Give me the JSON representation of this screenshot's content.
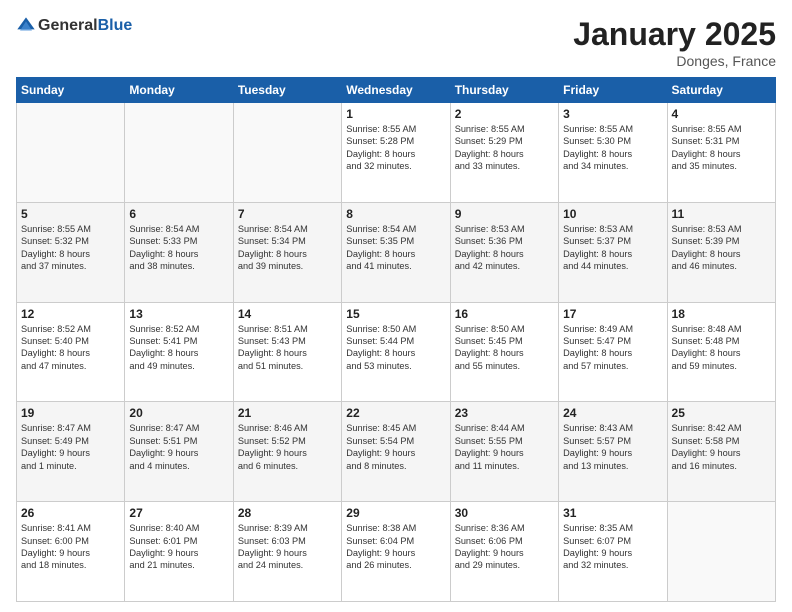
{
  "header": {
    "logo_general": "General",
    "logo_blue": "Blue",
    "title": "January 2025",
    "location": "Donges, France"
  },
  "weekdays": [
    "Sunday",
    "Monday",
    "Tuesday",
    "Wednesday",
    "Thursday",
    "Friday",
    "Saturday"
  ],
  "weeks": [
    [
      {
        "day": "",
        "info": ""
      },
      {
        "day": "",
        "info": ""
      },
      {
        "day": "",
        "info": ""
      },
      {
        "day": "1",
        "info": "Sunrise: 8:55 AM\nSunset: 5:28 PM\nDaylight: 8 hours\nand 32 minutes."
      },
      {
        "day": "2",
        "info": "Sunrise: 8:55 AM\nSunset: 5:29 PM\nDaylight: 8 hours\nand 33 minutes."
      },
      {
        "day": "3",
        "info": "Sunrise: 8:55 AM\nSunset: 5:30 PM\nDaylight: 8 hours\nand 34 minutes."
      },
      {
        "day": "4",
        "info": "Sunrise: 8:55 AM\nSunset: 5:31 PM\nDaylight: 8 hours\nand 35 minutes."
      }
    ],
    [
      {
        "day": "5",
        "info": "Sunrise: 8:55 AM\nSunset: 5:32 PM\nDaylight: 8 hours\nand 37 minutes."
      },
      {
        "day": "6",
        "info": "Sunrise: 8:54 AM\nSunset: 5:33 PM\nDaylight: 8 hours\nand 38 minutes."
      },
      {
        "day": "7",
        "info": "Sunrise: 8:54 AM\nSunset: 5:34 PM\nDaylight: 8 hours\nand 39 minutes."
      },
      {
        "day": "8",
        "info": "Sunrise: 8:54 AM\nSunset: 5:35 PM\nDaylight: 8 hours\nand 41 minutes."
      },
      {
        "day": "9",
        "info": "Sunrise: 8:53 AM\nSunset: 5:36 PM\nDaylight: 8 hours\nand 42 minutes."
      },
      {
        "day": "10",
        "info": "Sunrise: 8:53 AM\nSunset: 5:37 PM\nDaylight: 8 hours\nand 44 minutes."
      },
      {
        "day": "11",
        "info": "Sunrise: 8:53 AM\nSunset: 5:39 PM\nDaylight: 8 hours\nand 46 minutes."
      }
    ],
    [
      {
        "day": "12",
        "info": "Sunrise: 8:52 AM\nSunset: 5:40 PM\nDaylight: 8 hours\nand 47 minutes."
      },
      {
        "day": "13",
        "info": "Sunrise: 8:52 AM\nSunset: 5:41 PM\nDaylight: 8 hours\nand 49 minutes."
      },
      {
        "day": "14",
        "info": "Sunrise: 8:51 AM\nSunset: 5:43 PM\nDaylight: 8 hours\nand 51 minutes."
      },
      {
        "day": "15",
        "info": "Sunrise: 8:50 AM\nSunset: 5:44 PM\nDaylight: 8 hours\nand 53 minutes."
      },
      {
        "day": "16",
        "info": "Sunrise: 8:50 AM\nSunset: 5:45 PM\nDaylight: 8 hours\nand 55 minutes."
      },
      {
        "day": "17",
        "info": "Sunrise: 8:49 AM\nSunset: 5:47 PM\nDaylight: 8 hours\nand 57 minutes."
      },
      {
        "day": "18",
        "info": "Sunrise: 8:48 AM\nSunset: 5:48 PM\nDaylight: 8 hours\nand 59 minutes."
      }
    ],
    [
      {
        "day": "19",
        "info": "Sunrise: 8:47 AM\nSunset: 5:49 PM\nDaylight: 9 hours\nand 1 minute."
      },
      {
        "day": "20",
        "info": "Sunrise: 8:47 AM\nSunset: 5:51 PM\nDaylight: 9 hours\nand 4 minutes."
      },
      {
        "day": "21",
        "info": "Sunrise: 8:46 AM\nSunset: 5:52 PM\nDaylight: 9 hours\nand 6 minutes."
      },
      {
        "day": "22",
        "info": "Sunrise: 8:45 AM\nSunset: 5:54 PM\nDaylight: 9 hours\nand 8 minutes."
      },
      {
        "day": "23",
        "info": "Sunrise: 8:44 AM\nSunset: 5:55 PM\nDaylight: 9 hours\nand 11 minutes."
      },
      {
        "day": "24",
        "info": "Sunrise: 8:43 AM\nSunset: 5:57 PM\nDaylight: 9 hours\nand 13 minutes."
      },
      {
        "day": "25",
        "info": "Sunrise: 8:42 AM\nSunset: 5:58 PM\nDaylight: 9 hours\nand 16 minutes."
      }
    ],
    [
      {
        "day": "26",
        "info": "Sunrise: 8:41 AM\nSunset: 6:00 PM\nDaylight: 9 hours\nand 18 minutes."
      },
      {
        "day": "27",
        "info": "Sunrise: 8:40 AM\nSunset: 6:01 PM\nDaylight: 9 hours\nand 21 minutes."
      },
      {
        "day": "28",
        "info": "Sunrise: 8:39 AM\nSunset: 6:03 PM\nDaylight: 9 hours\nand 24 minutes."
      },
      {
        "day": "29",
        "info": "Sunrise: 8:38 AM\nSunset: 6:04 PM\nDaylight: 9 hours\nand 26 minutes."
      },
      {
        "day": "30",
        "info": "Sunrise: 8:36 AM\nSunset: 6:06 PM\nDaylight: 9 hours\nand 29 minutes."
      },
      {
        "day": "31",
        "info": "Sunrise: 8:35 AM\nSunset: 6:07 PM\nDaylight: 9 hours\nand 32 minutes."
      },
      {
        "day": "",
        "info": ""
      }
    ]
  ]
}
